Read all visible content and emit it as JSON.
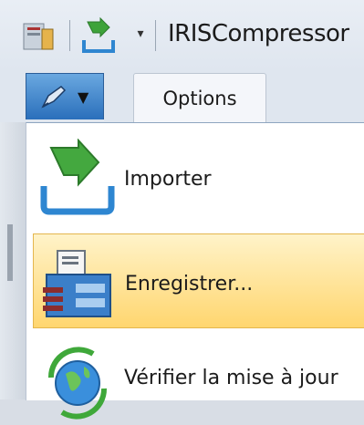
{
  "window": {
    "title": "IRISCompressor",
    "qat_dropdown_glyph": "▾"
  },
  "ribbon": {
    "app_menu_caret": "▼",
    "tabs": [
      {
        "label": "Options"
      }
    ]
  },
  "menu": {
    "items": [
      {
        "label": "Importer",
        "icon": "import-icon"
      },
      {
        "label": "Enregistrer...",
        "icon": "save-icon",
        "highlighted": true
      },
      {
        "label": "Vérifier la mise à jour",
        "icon": "update-globe-icon"
      }
    ]
  },
  "colors": {
    "highlight_top": "#fff3c9",
    "highlight_bottom": "#ffd66f",
    "app_menu_blue": "#2a6fbb"
  }
}
